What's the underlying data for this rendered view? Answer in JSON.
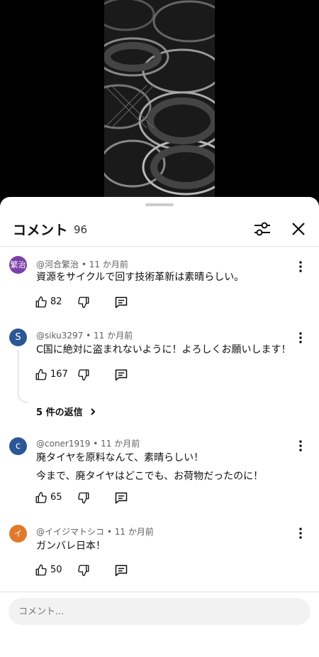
{
  "comments_header": {
    "title": "コメント",
    "count": "96"
  },
  "comments": [
    {
      "avatar_text": "繁治",
      "avatar_color": "#7b3fa8",
      "author": "@河合繁治",
      "time": "11 か月前",
      "lines": [
        "資源をサイクルで回す技術革新は素晴らしい。"
      ],
      "likes": "82"
    },
    {
      "avatar_text": "S",
      "avatar_color": "#2b5797",
      "author": "@siku3297",
      "time": "11 か月前",
      "lines": [
        "C国に絶対に盗まれないように！よろしくお願いします！"
      ],
      "likes": "167",
      "replies_label": "5 件の返信"
    },
    {
      "avatar_text": "c",
      "avatar_color": "#2b5797",
      "author": "@coner1919",
      "time": "11 か月前",
      "lines": [
        "廃タイヤを原料なんて、素晴らしい！",
        "今まで、廃タイヤはどこでも、お荷物だったのに！"
      ],
      "likes": "65"
    },
    {
      "avatar_text": "イ",
      "avatar_color": "#e07a2b",
      "author": "@イイジマトシコ",
      "time": "11 か月前",
      "lines": [
        "ガンバレ日本！"
      ],
      "likes": "50"
    }
  ],
  "input": {
    "placeholder": "コメント..."
  },
  "icons": {
    "filter": "sliders-icon",
    "close": "close-icon",
    "more": "more-vert-icon",
    "like": "thumb-up-icon",
    "dislike": "thumb-down-icon",
    "reply": "reply-icon",
    "chevron": "chevron-right-icon"
  }
}
